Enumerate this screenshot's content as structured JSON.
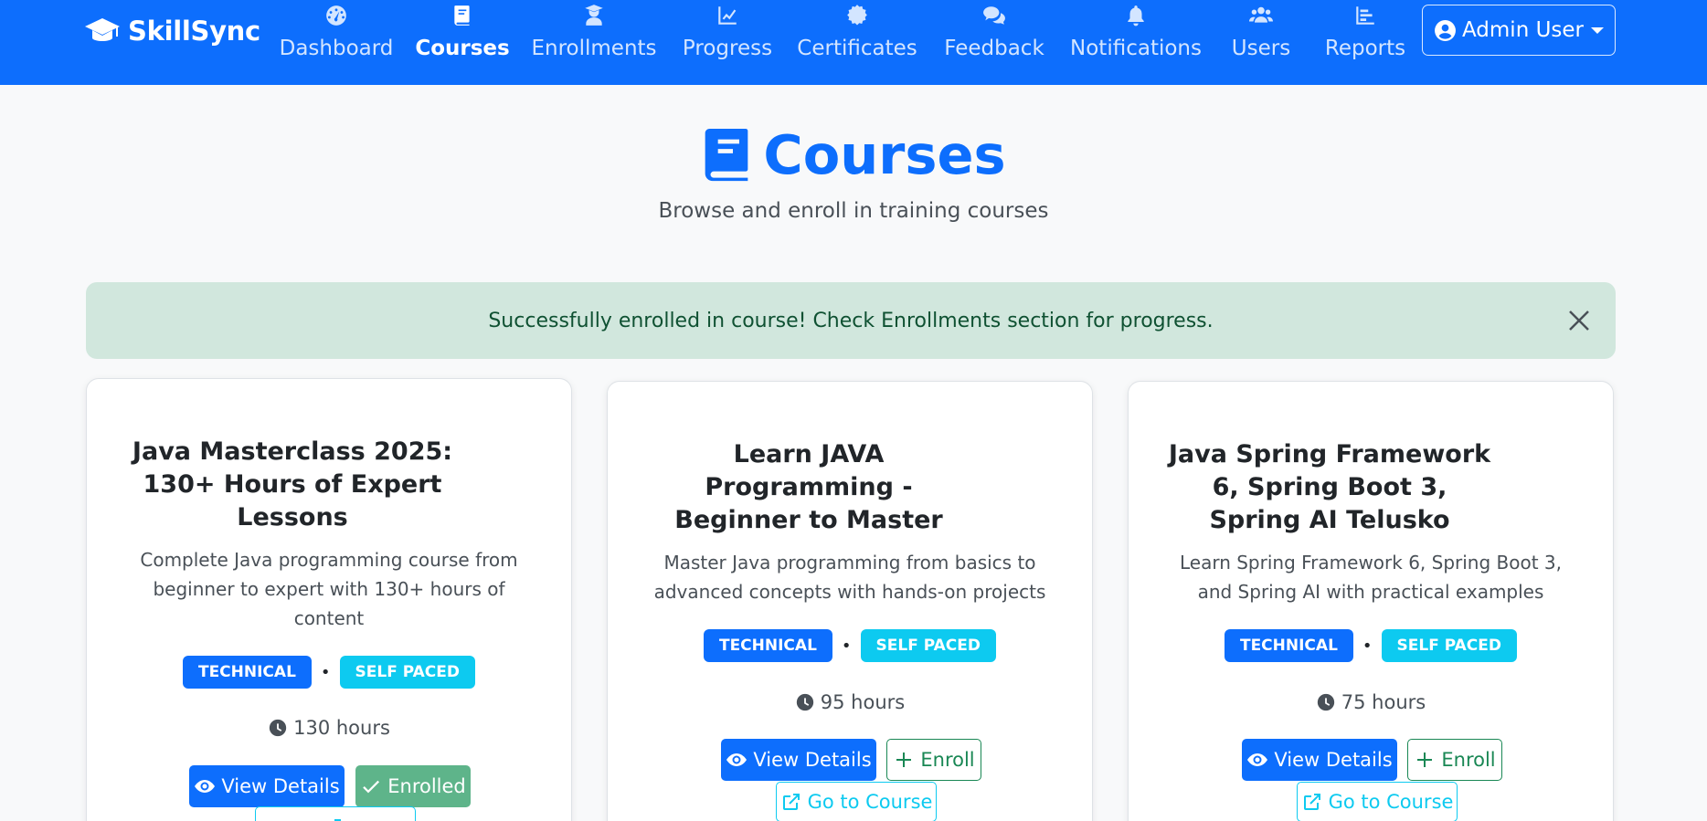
{
  "app": {
    "brand": "SkillSync"
  },
  "nav": {
    "items": [
      {
        "label": "Dashboard",
        "icon": "dashboard-icon"
      },
      {
        "label": "Courses",
        "icon": "book-icon",
        "active": true
      },
      {
        "label": "Enrollments",
        "icon": "graduate-icon"
      },
      {
        "label": "Progress",
        "icon": "chart-line-icon"
      },
      {
        "label": "Certificates",
        "icon": "certificate-icon"
      },
      {
        "label": "Feedback",
        "icon": "comments-icon"
      },
      {
        "label": "Notifications",
        "icon": "bell-icon"
      },
      {
        "label": "Users",
        "icon": "users-icon"
      },
      {
        "label": "Reports",
        "icon": "chart-bar-icon"
      }
    ],
    "user": {
      "label": "Admin User",
      "icon": "user-circle-icon"
    }
  },
  "header": {
    "title": "Courses",
    "subtitle": "Browse and enroll in training courses"
  },
  "alert": {
    "message": "Successfully enrolled in course! Check Enrollments section for progress."
  },
  "courses": [
    {
      "title_lines": [
        "Java Masterclass 2025:",
        "130+ Hours of Expert",
        "Lessons"
      ],
      "desc_lines": [
        "Complete Java programming course from",
        "beginner to expert with 130+ hours of",
        "content"
      ],
      "category": "TECHNICAL",
      "mode": "SELF PACED",
      "separator": "•",
      "hours": "130 hours",
      "view_label": "View Details",
      "status_label": "Enrolled",
      "enrolled": true
    },
    {
      "title_lines": [
        "Learn JAVA",
        "Programming -",
        "Beginner to Master"
      ],
      "desc_lines": [
        "Master Java programming from basics to",
        "advanced concepts with hands-on projects"
      ],
      "category": "TECHNICAL",
      "mode": "SELF PACED",
      "separator": "•",
      "hours": "95 hours",
      "view_label": "View Details",
      "status_label": "Enroll",
      "go_label": "Go to Course",
      "enrolled": false
    },
    {
      "title_lines": [
        "Java Spring Framework",
        "6, Spring Boot 3,",
        "Spring AI Telusko"
      ],
      "desc_lines": [
        "Learn Spring Framework 6, Spring Boot 3,",
        "and Spring AI with practical examples"
      ],
      "category": "TECHNICAL",
      "mode": "SELF PACED",
      "separator": "•",
      "hours": "75 hours",
      "view_label": "View Details",
      "status_label": "Enroll",
      "go_label": "Go to Course",
      "enrolled": false
    }
  ],
  "colors": {
    "primary": "#0d6efd",
    "info": "#0dcaf0",
    "success": "#198754",
    "alert_bg": "#d1e7dd"
  }
}
